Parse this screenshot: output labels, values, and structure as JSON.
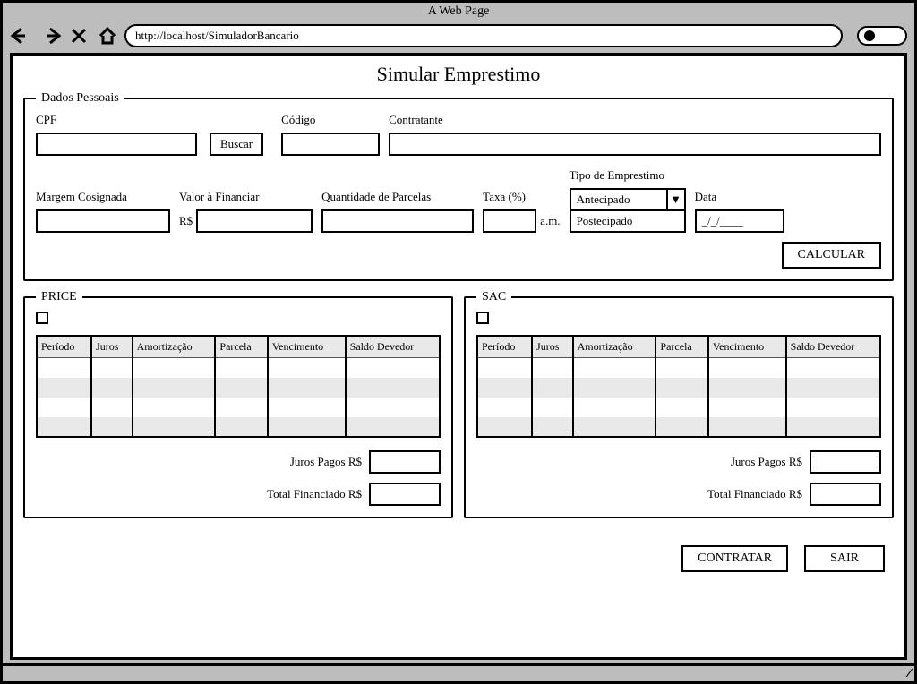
{
  "browser": {
    "title": "A Web Page",
    "url": "http://localhost/SimuladorBancario"
  },
  "page": {
    "heading": "Simular Emprestimo"
  },
  "dados": {
    "legend": "Dados Pessoais",
    "cpf_label": "CPF",
    "buscar_label": "Buscar",
    "codigo_label": "Código",
    "contratante_label": "Contratante",
    "margem_label": "Margem Cosignada",
    "valor_label": "Valor à Financiar",
    "valor_prefix": "R$",
    "qtd_parcelas_label": "Quantidade de Parcelas",
    "taxa_label": "Taxa (%)",
    "taxa_suffix": "a.m.",
    "tipo_label": "Tipo de Emprestimo",
    "tipo_options": [
      "Antecipado",
      "Postecipado"
    ],
    "tipo_selected": "Antecipado",
    "data_label": "Data",
    "data_placeholder": "_/_/____",
    "calcular_label": "CALCULAR"
  },
  "columns": [
    "Período",
    "Juros",
    "Amortização",
    "Parcela",
    "Vencimento",
    "Saldo Devedor"
  ],
  "price": {
    "legend": "PRICE",
    "juros_pagos_label": "Juros Pagos  R$",
    "total_fin_label": "Total Financiado  R$"
  },
  "sac": {
    "legend": "SAC",
    "juros_pagos_label": "Juros Pagos  R$",
    "total_fin_label": "Total Financiado  R$"
  },
  "footer": {
    "contratar_label": "CONTRATAR",
    "sair_label": "SAIR"
  }
}
